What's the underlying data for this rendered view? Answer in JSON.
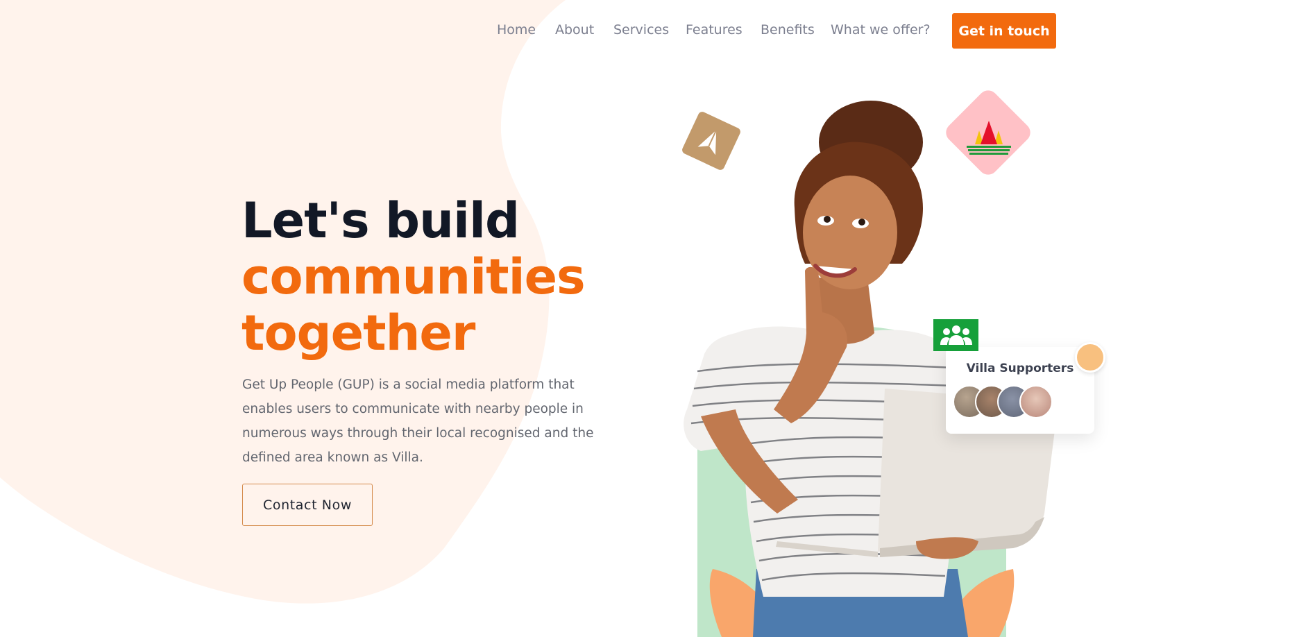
{
  "nav": {
    "items": [
      {
        "label": "Home"
      },
      {
        "label": "About"
      },
      {
        "label": "Services"
      },
      {
        "label": "Features"
      },
      {
        "label": "Benefits"
      },
      {
        "label": "What we offer?"
      }
    ],
    "cta_label": "Get in touch"
  },
  "hero": {
    "title_line1": "Let's build",
    "title_line2": "communities",
    "title_line3": "together",
    "description": "Get Up People (GUP) is a social media platform that enables users to communicate with nearby people in numerous ways through their local recognised and the defined area known as Villa.",
    "contact_label": "Contact Now"
  },
  "supporters_card": {
    "title": "Villa Supporters"
  },
  "icons": {
    "group": "group-icon",
    "plane": "paper-plane-icon",
    "logo": "mountain-logo-icon"
  },
  "colors": {
    "accent": "#f26a0e",
    "blob": "#fff3ec",
    "mint": "#bfe6c9",
    "peach": "#f9a66b",
    "badge_green": "#16a03a",
    "badge_tan": "#c29a6b",
    "badge_pink": "#ffc1c6"
  }
}
